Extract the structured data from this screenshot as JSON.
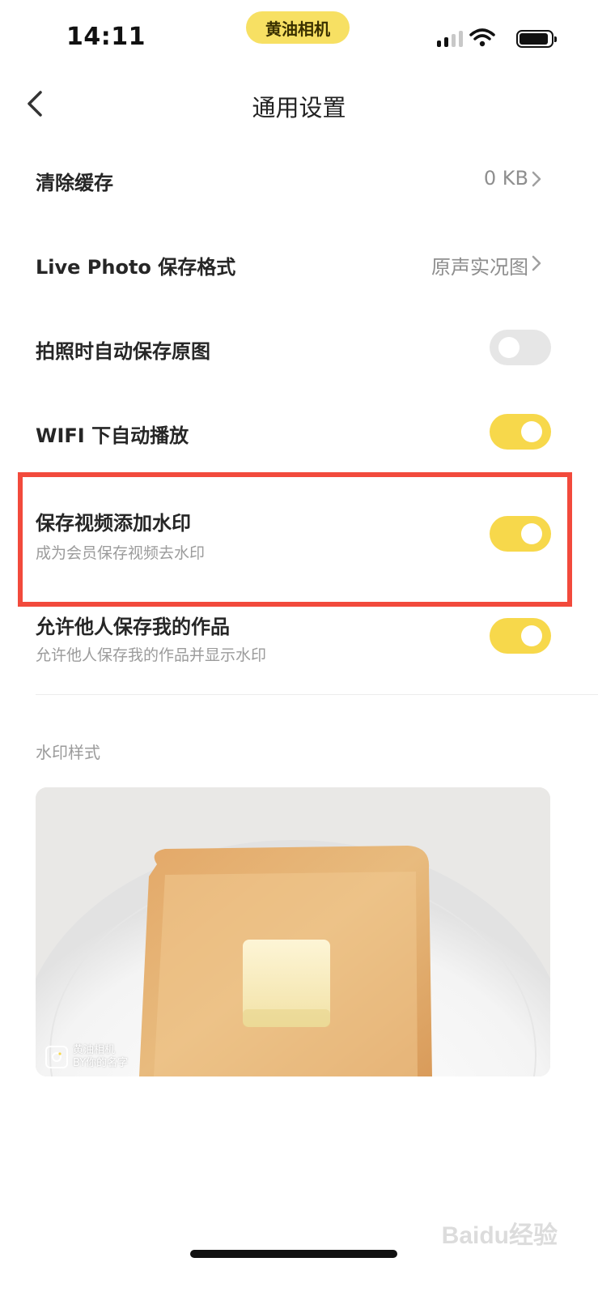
{
  "status_bar": {
    "time": "14:11",
    "app_pill": "黄油相机"
  },
  "nav": {
    "title": "通用设置"
  },
  "settings": [
    {
      "title": "清除缓存",
      "value": "0 KB"
    },
    {
      "title": "Live Photo 保存格式",
      "value": "原声实况图"
    },
    {
      "title": "拍照时自动保存原图",
      "toggle": false
    },
    {
      "title": "WIFI 下自动播放",
      "toggle": true
    },
    {
      "title": "保存视频添加水印",
      "subtitle": "成为会员保存视频去水印",
      "toggle": true
    },
    {
      "title": "允许他人保存我的作品",
      "subtitle": "允许他人保存我的作品并显示水印",
      "toggle": true
    }
  ],
  "watermark_section": {
    "label": "水印样式",
    "preview_watermark_line1": "黄油相机",
    "preview_watermark_line2": "BY你的名字"
  },
  "footer_watermark": "Baidu经验",
  "colors": {
    "accent_toggle": "#f7d84b",
    "app_pill": "#f7e063",
    "highlight_box": "#f24a3c"
  },
  "icons": [
    "back-chevron-icon",
    "chevron-right-icon",
    "cellular-signal-icon",
    "wifi-icon",
    "battery-icon",
    "camera-logo-icon"
  ]
}
